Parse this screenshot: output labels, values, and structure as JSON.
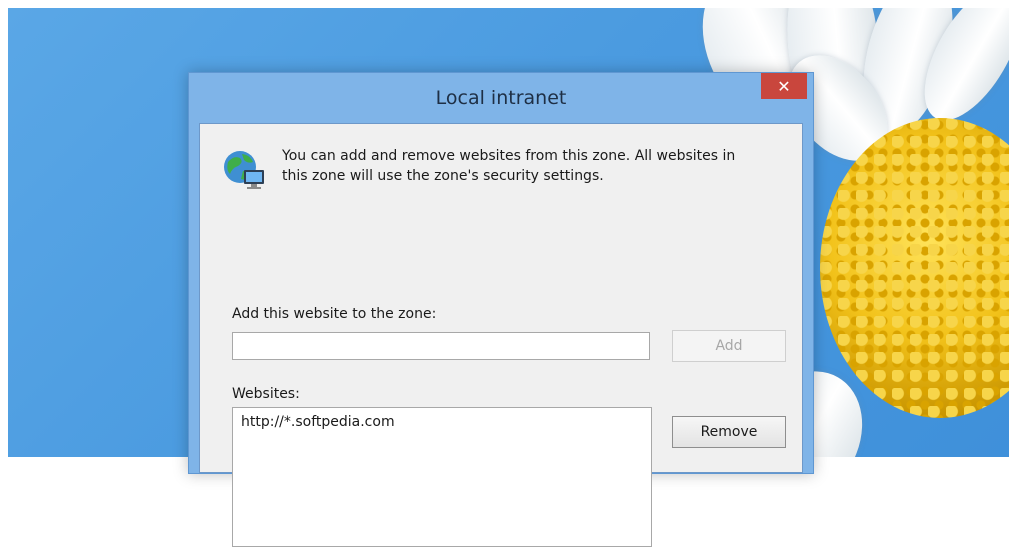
{
  "dialog": {
    "title": "Local intranet",
    "close_label": "✕",
    "intro_text": "You can add and remove websites from this zone. All websites in this zone will use the zone's security settings.",
    "add_label": "Add this website to the zone:",
    "add_input_value": "",
    "add_button": "Add",
    "websites_label": "Websites:",
    "websites": [
      "http://*.softpedia.com"
    ],
    "remove_button": "Remove"
  },
  "icons": {
    "globe": "globe-computer-icon"
  },
  "colors": {
    "desktop_blue": "#4b9be0",
    "window_frame": "#7fb4e8",
    "close_red": "#c9463d",
    "client_bg": "#f0f0f0"
  }
}
